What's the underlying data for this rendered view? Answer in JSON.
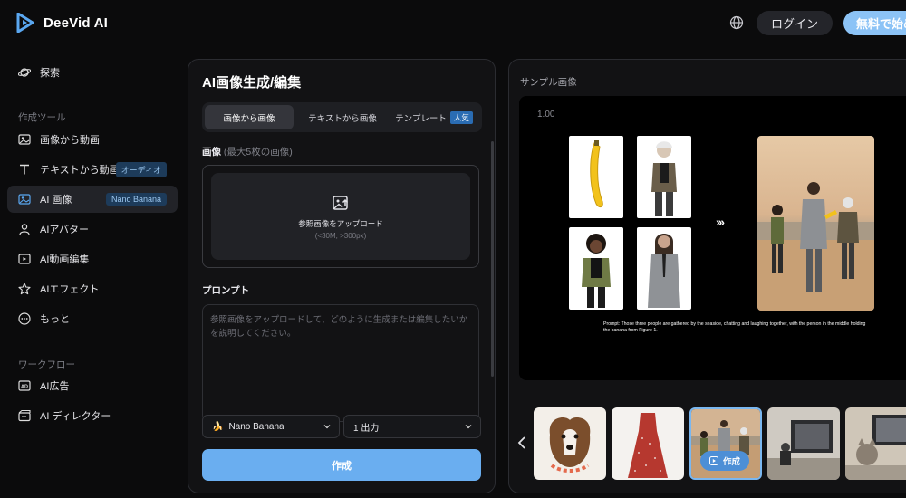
{
  "header": {
    "brand": "DeeVid AI",
    "login_label": "ログイン",
    "cta_label": "無料で始め",
    "accent_color": "#8cc3f6"
  },
  "sidebar": {
    "explore": "探索",
    "tools_heading": "作成ツール",
    "items": [
      {
        "label": "画像から動画",
        "icon": "image-icon"
      },
      {
        "label": "テキストから動画",
        "icon": "text-icon",
        "badge": "オーディオ"
      },
      {
        "label": "AI 画像",
        "icon": "ai-image-icon",
        "badge": "Nano Banana",
        "active": true
      },
      {
        "label": "AIアバター",
        "icon": "person-icon"
      },
      {
        "label": "AI動画編集",
        "icon": "video-edit-icon"
      },
      {
        "label": "AIエフェクト",
        "icon": "star-icon"
      },
      {
        "label": "もっと",
        "icon": "more-icon"
      }
    ],
    "workflow_heading": "ワークフロー",
    "workflow_items": [
      {
        "label": "AI広告",
        "icon": "ad-icon"
      },
      {
        "label": "AI ディレクター",
        "icon": "director-icon"
      }
    ]
  },
  "editor": {
    "title": "AI画像生成/編集",
    "tabs": [
      {
        "label": "画像から画像",
        "active": true
      },
      {
        "label": "テキストから画像"
      },
      {
        "label": "テンプレート",
        "badge": "人気"
      }
    ],
    "image_label": "画像",
    "image_sublabel": "(最大5枚の画像)",
    "upload_text": "参照画像をアップロード",
    "upload_hint": "(<30M, >300px)",
    "prompt_label": "プロンプト",
    "prompt_placeholder": "参照画像をアップロードして、どのように生成または編集したいかを説明してください。",
    "model_select": "Nano Banana",
    "model_emoji": "🍌",
    "output_select": "1 出力",
    "create_label": "作成"
  },
  "sample": {
    "title": "サンプル画像",
    "version": "1.00",
    "caption": "Prompt: Those three people are gathered by the seaside, chatting and laughing together, with the person in the middle holding the banana from Figure 1.",
    "chip_label": "作成"
  }
}
